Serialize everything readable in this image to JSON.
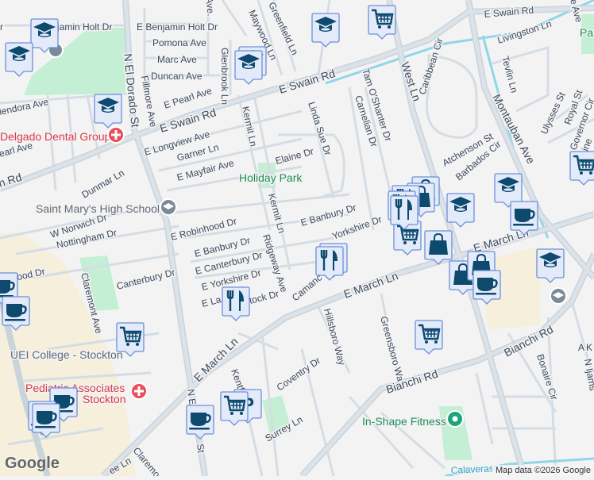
{
  "streets": {
    "benjamin_holt_w": "jamin Holt Dr",
    "benjamin_holt_e": "E Benjamin Holt Dr",
    "pomona": "Pomona Ave",
    "marc": "Marc Ave",
    "duncan": "Duncan Ave",
    "glenbrook": "Glenbrook Ln",
    "maywood": "Maywood Ln",
    "greenfield": "Greenfield Ln",
    "mendora": "lendora Ave",
    "el_dorado": "N El Dorado St",
    "fillmore": "Fillmore Ave",
    "pearl_e": "E Pearl Ave",
    "swain_main": "E Swain Rd",
    "swain_left": "n Rd",
    "swain_right": "E Swain Rd",
    "pearl_w": "earl Ave",
    "longview": "E Longview Ave",
    "garner": "Garner Ln",
    "mayfair": "E Mayfair Ave",
    "kermit_1": "Kermit Ln",
    "kermit_2": "Kermit Ln",
    "elaine": "Elaine Dr",
    "linda_sue": "Linda Sue Dr",
    "dunmar": "Dunmar Ln",
    "norwich": "W Norwich Dr",
    "robinhood_e": "E Robinhood Dr",
    "robinhood_w": "binhood Dr",
    "nottingham": "Nottingham Dr",
    "banbury_1": "E Banbury Dr",
    "banbury_2": "E Banbury Dr",
    "canterbury_e": "E Canterbury Dr",
    "canterbury": "Canterbury Dr",
    "ridgeway": "Ridgeway Ave",
    "yorkshire_e": "E Yorkshire Dr",
    "yorkshire_2": "Yorkshire Dr",
    "claremont": "Claremont Ave",
    "lan": "E La",
    "stock": "tock Dr",
    "camanche": "Camanc",
    "march_1": "E March Ln",
    "march_2": "E March Ln",
    "march_3": "E March Ln",
    "hillsboro": "Hillsboro Way",
    "greensboro": "Greensboro Way",
    "bianchi_1": "Bianchi Rd",
    "bianchi_2": "Bianchi Rd",
    "coventry": "Coventry Dr",
    "kentfield": "Kentfie",
    "surrey": "Surrey Ln",
    "el_dorado_2": "N El",
    "el_dorado_3": "St",
    "claremo": "Claremo",
    "tee": "ee Ln",
    "tam": "Tam O'Shanter Dr",
    "carnelian": "Carnelian Dr",
    "west": "West Ln",
    "caribbean": "Caribbean Cir",
    "livingston": "Livingston Ln",
    "tevlin": "Tevlin Ln",
    "montauban": "Montauban Ave",
    "atchenson": "Atchenson St",
    "barbados": "Barbados Cir",
    "ulysses": "Ulysses St",
    "royal": "Royal St",
    "governor": "Governor Cir",
    "lorraine": "rraine",
    "ave_top": "e Ave",
    "ave_top2": "Ave.",
    "bonaire": "Bonaire Cir",
    "n_ijams": "N Ijams",
    "akl": "AKI",
    "calaveras": "Calaveras",
    "park_right": "Par",
    "r_top": "r"
  },
  "places": {
    "holiday_park": "Holiday Park",
    "delgado": "Delgado Dental Group",
    "saint_marys": "Saint Mary's High School",
    "uei": "UEI College - Stockton",
    "pediatric_1": "Pediatric Associates",
    "pediatric_2": "Stockton",
    "in_shape": "In-Shape Fitness"
  },
  "colors": {
    "marker_bg": "#e3ebfb",
    "marker_border": "#6c8fd6",
    "marker_icon": "#0d4a6e",
    "medical": "#e94e5b",
    "park_text": "#1e8e5a",
    "park": "#c4efd4",
    "campus": "#f5efdc"
  },
  "branding": {
    "logo": "Google",
    "attribution": "Map data ©2026 Google"
  }
}
